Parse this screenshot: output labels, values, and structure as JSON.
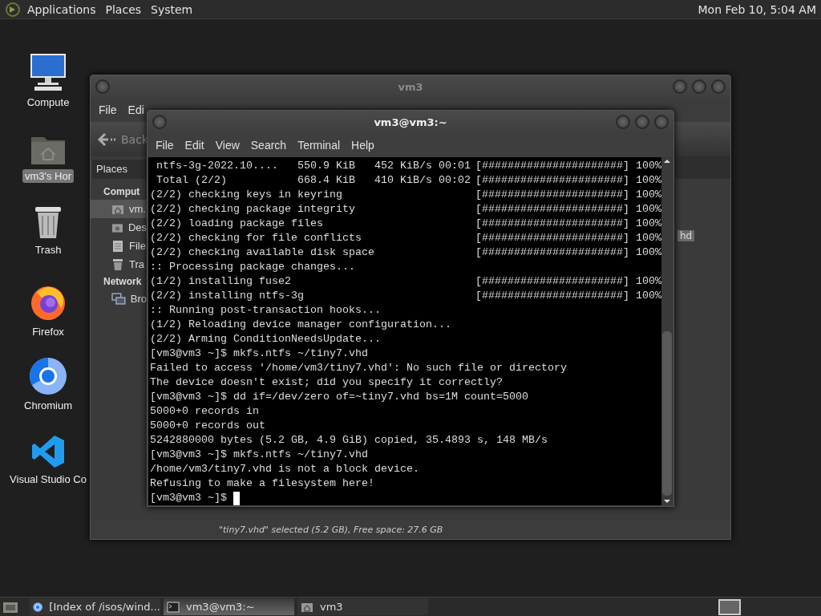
{
  "top_panel": {
    "menus": [
      "Applications",
      "Places",
      "System"
    ],
    "clock": "Mon Feb 10, 5:04 AM"
  },
  "desktop_icons": [
    {
      "kind": "computer",
      "label": "Compute",
      "selected": false
    },
    {
      "kind": "home",
      "label": "vm3's Hor",
      "selected": true
    },
    {
      "kind": "trash",
      "label": "Trash",
      "selected": false
    },
    {
      "kind": "firefox",
      "label": "Firefox",
      "selected": false
    },
    {
      "kind": "chromium",
      "label": "Chromium",
      "selected": false
    },
    {
      "kind": "vscode",
      "label": "Visual Studio Co",
      "selected": false
    }
  ],
  "file_manager": {
    "title": "vm3",
    "menus": [
      "File",
      "Edi"
    ],
    "back_label": "Back",
    "sidebar_header": "Places",
    "sidebar": [
      {
        "kind": "heading",
        "label": "Comput",
        "selected": false
      },
      {
        "kind": "home",
        "label": "vm.",
        "selected": true
      },
      {
        "kind": "folder",
        "label": "Des",
        "selected": false
      },
      {
        "kind": "document",
        "label": "File",
        "selected": false
      },
      {
        "kind": "trash",
        "label": "Tra",
        "selected": false
      },
      {
        "kind": "heading",
        "label": "Network",
        "selected": false
      },
      {
        "kind": "network",
        "label": "Bro",
        "selected": false
      }
    ],
    "file_label": "hd",
    "status": "\"tiny7.vhd\" selected (5.2 GB), Free space: 27.6 GB"
  },
  "terminal": {
    "title": "vm3@vm3:~",
    "menus": [
      "File",
      "Edit",
      "View",
      "Search",
      "Terminal",
      "Help"
    ],
    "cursor_visible": true,
    "lines": [
      {
        "text": " ntfs-3g-2022.10....   550.9 KiB   452 KiB/s 00:01",
        "bar": "[######################] 100%"
      },
      {
        "text": " Total (2/2)           668.4 KiB   410 KiB/s 00:02",
        "bar": "[######################] 100%"
      },
      {
        "text": "(2/2) checking keys in keyring",
        "bar": "[######################] 100%"
      },
      {
        "text": "(2/2) checking package integrity",
        "bar": "[######################] 100%"
      },
      {
        "text": "(2/2) loading package files",
        "bar": "[######################] 100%"
      },
      {
        "text": "(2/2) checking for file conflicts",
        "bar": "[######################] 100%"
      },
      {
        "text": "(2/2) checking available disk space",
        "bar": "[######################] 100%"
      },
      {
        "text": ":: Processing package changes..."
      },
      {
        "text": "(1/2) installing fuse2",
        "bar": "[######################] 100%"
      },
      {
        "text": "(2/2) installing ntfs-3g",
        "bar": "[######################] 100%"
      },
      {
        "text": ":: Running post-transaction hooks..."
      },
      {
        "text": "(1/2) Reloading device manager configuration..."
      },
      {
        "text": "(2/2) Arming ConditionNeedsUpdate..."
      },
      {
        "text": "[vm3@vm3 ~]$ mkfs.ntfs ~/tiny7.vhd"
      },
      {
        "text": "Failed to access '/home/vm3/tiny7.vhd': No such file or directory"
      },
      {
        "text": "The device doesn't exist; did you specify it correctly?"
      },
      {
        "text": "[vm3@vm3 ~]$ dd if=/dev/zero of=~tiny7.vhd bs=1M count=5000"
      },
      {
        "text": "5000+0 records in"
      },
      {
        "text": "5000+0 records out"
      },
      {
        "text": "5242880000 bytes (5.2 GB, 4.9 GiB) copied, 35.4893 s, 148 MB/s"
      },
      {
        "text": "[vm3@vm3 ~]$ mkfs.ntfs ~/tiny7.vhd"
      },
      {
        "text": "/home/vm3/tiny7.vhd is not a block device."
      },
      {
        "text": "Refusing to make a filesystem here!"
      },
      {
        "text": "[vm3@vm3 ~]$"
      }
    ]
  },
  "taskbar": {
    "items": [
      {
        "kind": "browser",
        "label": "[Index of /isos/wind...",
        "selected": false
      },
      {
        "kind": "terminal",
        "label": "vm3@vm3:~",
        "selected": true
      },
      {
        "kind": "folder",
        "label": "vm3",
        "selected": false
      }
    ]
  }
}
